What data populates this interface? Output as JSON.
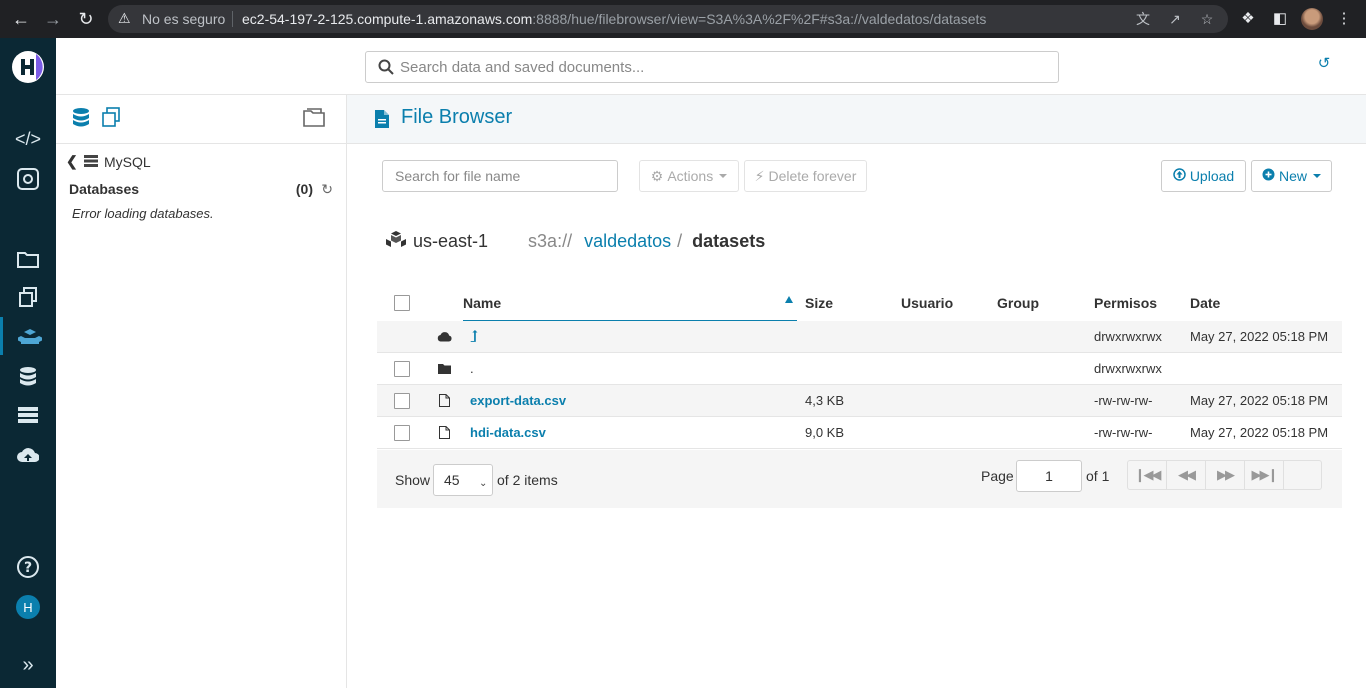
{
  "browser": {
    "insecure_label": "No es seguro",
    "url_host": "ec2-54-197-2-125.compute-1.amazonaws.com",
    "url_rest": ":8888/hue/filebrowser/view=S3A%3A%2F%2F#s3a://valdedatos/datasets"
  },
  "topbar": {
    "search_placeholder": "Search data and saved documents..."
  },
  "leftnav": {
    "user_initial": "H"
  },
  "assist": {
    "crumb_label": "MySQL",
    "databases_label": "Databases",
    "databases_count": "(0)",
    "error_text": "Error loading databases."
  },
  "main": {
    "title": "File Browser",
    "file_search_placeholder": "Search for file name",
    "actions_label": "Actions",
    "delete_label": "Delete forever",
    "upload_label": "Upload",
    "new_label": "New",
    "path": {
      "region": "us-east-1",
      "scheme": "s3a://",
      "bucket": "valdedatos",
      "separator": "/",
      "current": "datasets"
    },
    "columns": {
      "name": "Name",
      "size": "Size",
      "user": "Usuario",
      "group": "Group",
      "perms": "Permisos",
      "date": "Date"
    },
    "rows": [
      {
        "name": "",
        "size": "",
        "user": "",
        "group": "",
        "perms": "drwxrwxrwx",
        "date": "May 27, 2022 05:18 PM"
      },
      {
        "name": ".",
        "size": "",
        "user": "",
        "group": "",
        "perms": "drwxrwxrwx",
        "date": ""
      },
      {
        "name": "export-data.csv",
        "size": "4,3 KB",
        "user": "",
        "group": "",
        "perms": "-rw-rw-rw-",
        "date": "May 27, 2022 05:18 PM"
      },
      {
        "name": "hdi-data.csv",
        "size": "9,0 KB",
        "user": "",
        "group": "",
        "perms": "-rw-rw-rw-",
        "date": "May 27, 2022 05:18 PM"
      }
    ],
    "pager": {
      "show_label": "Show",
      "page_size": "45",
      "of_items": "of 2 items",
      "page_label": "Page",
      "page_value": "1",
      "of_pages": "of 1"
    }
  },
  "colors": {
    "accent": "#0b7fad",
    "nav_bg": "#0b2834",
    "chrome_bg": "#202124"
  }
}
